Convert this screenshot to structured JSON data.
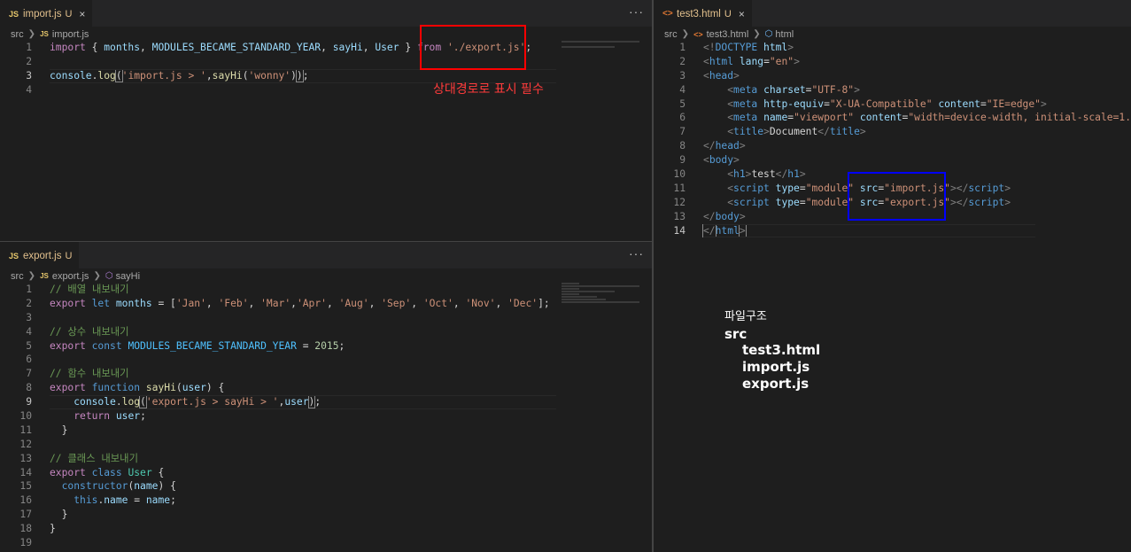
{
  "import_pane": {
    "tab": {
      "icon": "JS",
      "name": "import.js",
      "badge": "U",
      "close": "×"
    },
    "more": "···",
    "breadcrumb": {
      "folder": "src",
      "icon": "JS",
      "file": "import.js"
    },
    "lines": [
      "1",
      "2",
      "3",
      "4"
    ],
    "annotation": "상대경로로 표시 필수"
  },
  "export_pane": {
    "tab": {
      "icon": "JS",
      "name": "export.js",
      "badge": "U"
    },
    "more": "···",
    "breadcrumb": {
      "folder": "src",
      "icon": "JS",
      "file": "export.js",
      "symbol": "sayHi"
    },
    "lines": [
      "1",
      "2",
      "3",
      "4",
      "5",
      "6",
      "7",
      "8",
      "9",
      "10",
      "11",
      "12",
      "13",
      "14",
      "15",
      "16",
      "17",
      "18",
      "19"
    ]
  },
  "html_pane": {
    "tab": {
      "icon": "<>",
      "name": "test3.html",
      "badge": "U",
      "close": "×"
    },
    "breadcrumb": {
      "folder": "src",
      "icon": "<>",
      "file": "test3.html",
      "symbol": "html"
    },
    "lines": [
      "1",
      "2",
      "3",
      "4",
      "5",
      "6",
      "7",
      "8",
      "9",
      "10",
      "11",
      "12",
      "13",
      "14"
    ]
  },
  "file_structure": {
    "title": "파일구조",
    "root": "src",
    "files": [
      "test3.html",
      "import.js",
      "export.js"
    ]
  },
  "colors": {
    "annotation_box": "#ff0000",
    "highlight_box": "#0000ff"
  }
}
